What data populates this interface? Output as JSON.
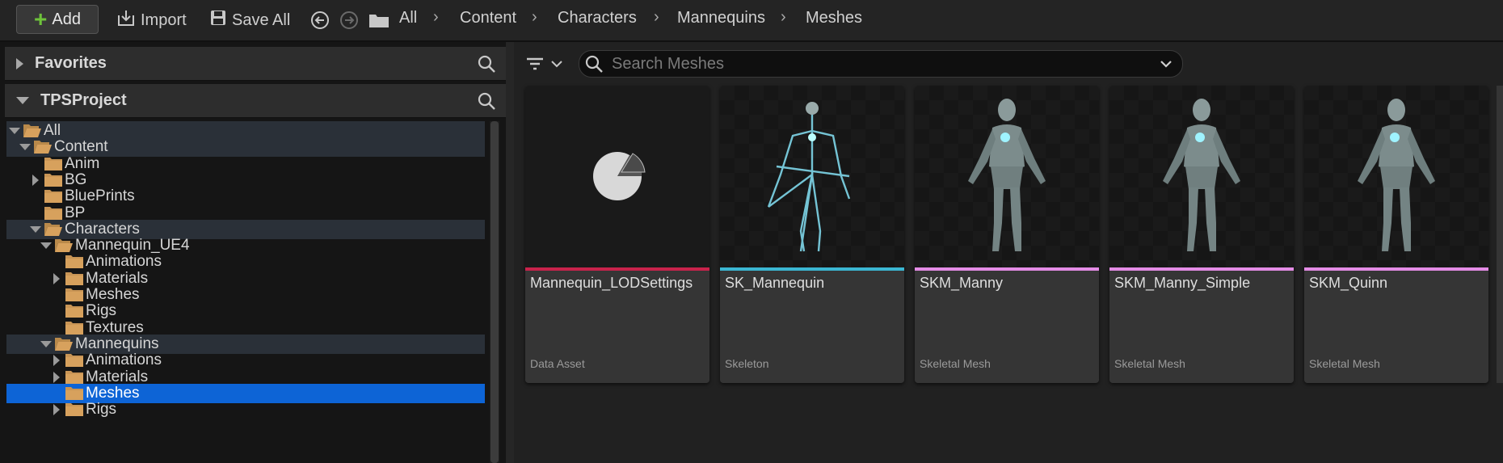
{
  "toolbar": {
    "add_label": "Add",
    "import_label": "Import",
    "save_all_label": "Save All",
    "breadcrumb": [
      "All",
      "Content",
      "Characters",
      "Mannequins",
      "Meshes"
    ]
  },
  "sources": {
    "favorites_label": "Favorites",
    "project_label": "TPSProject"
  },
  "tree": [
    {
      "label": "All",
      "depth": 0,
      "expand": "open",
      "state": "highlight"
    },
    {
      "label": "Content",
      "depth": 1,
      "expand": "open",
      "state": "highlight"
    },
    {
      "label": "Anim",
      "depth": 2,
      "expand": "none",
      "state": ""
    },
    {
      "label": "BG",
      "depth": 2,
      "expand": "closed",
      "state": ""
    },
    {
      "label": "BluePrints",
      "depth": 2,
      "expand": "none",
      "state": ""
    },
    {
      "label": "BP",
      "depth": 2,
      "expand": "none",
      "state": ""
    },
    {
      "label": "Characters",
      "depth": 2,
      "expand": "open",
      "state": "highlight"
    },
    {
      "label": "Mannequin_UE4",
      "depth": 3,
      "expand": "open",
      "state": ""
    },
    {
      "label": "Animations",
      "depth": 4,
      "expand": "none",
      "state": ""
    },
    {
      "label": "Materials",
      "depth": 4,
      "expand": "closed",
      "state": ""
    },
    {
      "label": "Meshes",
      "depth": 4,
      "expand": "none",
      "state": ""
    },
    {
      "label": "Rigs",
      "depth": 4,
      "expand": "none",
      "state": ""
    },
    {
      "label": "Textures",
      "depth": 4,
      "expand": "none",
      "state": ""
    },
    {
      "label": "Mannequins",
      "depth": 3,
      "expand": "open",
      "state": "highlight"
    },
    {
      "label": "Animations",
      "depth": 4,
      "expand": "closed",
      "state": ""
    },
    {
      "label": "Materials",
      "depth": 4,
      "expand": "closed",
      "state": ""
    },
    {
      "label": "Meshes",
      "depth": 4,
      "expand": "none",
      "state": "selected"
    },
    {
      "label": "Rigs",
      "depth": 4,
      "expand": "closed",
      "state": ""
    }
  ],
  "search": {
    "placeholder": "Search Meshes"
  },
  "assets": [
    {
      "name": "Mannequin_LODSettings",
      "type": "Data Asset",
      "color": "#c8234b",
      "thumb": "data-asset-icon"
    },
    {
      "name": "SK_Mannequin",
      "type": "Skeleton",
      "color": "#3bb7d3",
      "thumb": "skeleton-figure"
    },
    {
      "name": "SKM_Manny",
      "type": "Skeletal Mesh",
      "color": "#e48ce6",
      "thumb": "mannequin-figure"
    },
    {
      "name": "SKM_Manny_Simple",
      "type": "Skeletal Mesh",
      "color": "#e48ce6",
      "thumb": "mannequin-figure"
    },
    {
      "name": "SKM_Quinn",
      "type": "Skeletal Mesh",
      "color": "#e48ce6",
      "thumb": "mannequin-figure"
    }
  ]
}
